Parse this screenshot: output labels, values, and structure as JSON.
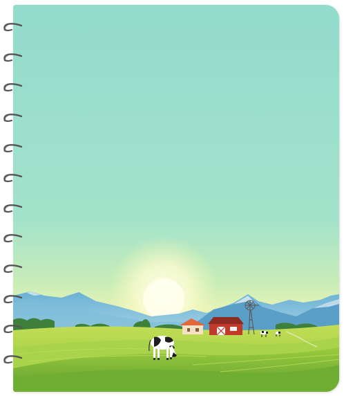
{
  "notebook": {
    "ring_count": 12,
    "colors": {
      "sky_top": "#95DCCB",
      "sky_mid": "#A3E3C9",
      "horizon_glow": "#F6F7B8",
      "mountain": "#5EA6CC",
      "mountain_light": "#8CC4DE",
      "field_dark": "#5E9E2F",
      "field": "#8DC43A",
      "field_light": "#B4D94E",
      "barn_red": "#C0392B",
      "house_roof": "#E2683C",
      "ring_metal": "#555555"
    },
    "scene": {
      "icons": [
        "sun-icon",
        "mountains-icon",
        "barn-icon",
        "farmhouse-icon",
        "windmill-icon",
        "cow-icon"
      ]
    }
  }
}
